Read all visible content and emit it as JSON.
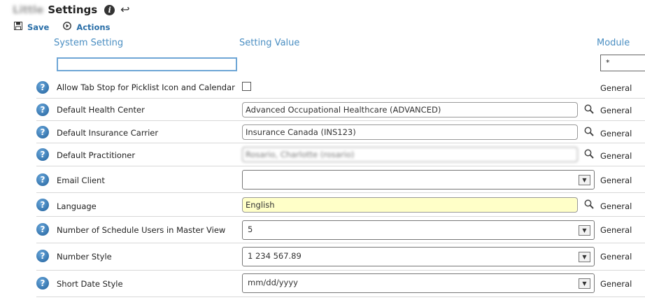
{
  "header": {
    "user_name": "Little",
    "title": "Settings"
  },
  "toolbar": {
    "save_label": "Save",
    "actions_label": "Actions"
  },
  "columns": {
    "setting": "System Setting",
    "value": "Setting Value",
    "module": "Module"
  },
  "filters": {
    "setting_value": "",
    "module_value": "*"
  },
  "rows": [
    {
      "label": "Allow Tab Stop for Picklist Icon and Calendar",
      "control": "checkbox",
      "checked": false,
      "module": "General"
    },
    {
      "label": "Default Health Center",
      "control": "lookup",
      "value": "Advanced Occupational Healthcare (ADVANCED)",
      "module": "General"
    },
    {
      "label": "Default Insurance Carrier",
      "control": "lookup",
      "value": "Insurance Canada (INS123)",
      "module": "General"
    },
    {
      "label": "Default Practitioner",
      "control": "lookup",
      "value": "Rosario, Charlotte (rosario)",
      "module": "General"
    },
    {
      "label": "Email Client",
      "control": "select",
      "value": "",
      "module": "General"
    },
    {
      "label": "Language",
      "control": "lookup",
      "value": "English",
      "module": "General"
    },
    {
      "label": "Number of Schedule Users in Master View",
      "control": "select",
      "value": "5",
      "module": "General"
    },
    {
      "label": "Number Style",
      "control": "select",
      "value": "1 234 567.89",
      "module": "General"
    },
    {
      "label": "Short Date Style",
      "control": "select",
      "value": "mm/dd/yyyy",
      "module": "General"
    }
  ],
  "colors": {
    "accent": "#4a8ec2",
    "link": "#2a6fa8",
    "highlight": "#ffffc8",
    "help_icon": "#2f77b8"
  }
}
